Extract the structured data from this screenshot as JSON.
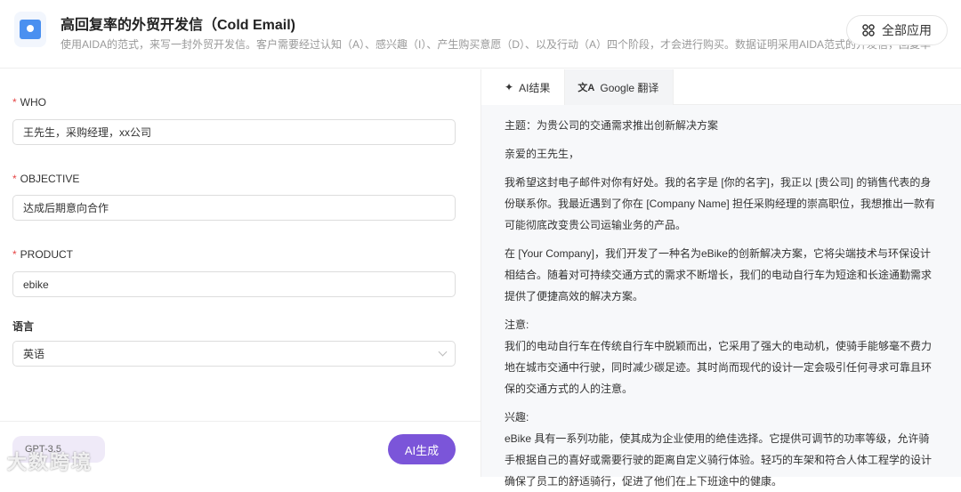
{
  "header": {
    "title": "高回复率的外贸开发信（Cold Email)",
    "description": "使用AIDA的范式，来写一封外贸开发信。客户需要经过认知（A）、感兴趣（I）、产生购买意愿（D）、以及行动（A）四个阶段，才会进行购买。数据证明采用AIDA范式的开发信，回复率",
    "all_apps_label": "全部应用"
  },
  "form": {
    "fields": [
      {
        "label": "WHO",
        "required": true,
        "value": "王先生，采购经理，xx公司"
      },
      {
        "label": "OBJECTIVE",
        "required": true,
        "value": "达成后期意向合作"
      },
      {
        "label": "PRODUCT",
        "required": true,
        "value": "ebike"
      },
      {
        "label": "语言",
        "required": false,
        "value": "英语"
      }
    ],
    "model_badge": "GPT-3.5",
    "watermark": "大数跨境",
    "generate_label": "AI生成"
  },
  "tabs": [
    {
      "label": "AI结果",
      "icon": "sparkle-icon"
    },
    {
      "label": "Google 翻译",
      "icon": "translate-icon"
    }
  ],
  "result": {
    "subject": "主题：为贵公司的交通需求推出创新解决方案",
    "greeting": "亲爱的王先生，",
    "p1": "我希望这封电子邮件对你有好处。我的名字是 [你的名字]，我正以 [贵公司] 的销售代表的身份联系你。我最近遇到了你在 [Company Name] 担任采购经理的崇高职位，我想推出一款有可能彻底改变贵公司运输业务的产品。",
    "p2": "在 [Your Company]，我们开发了一种名为eBike的创新解决方案，它将尖端技术与环保设计相结合。随着对可持续交通方式的需求不断增长，我们的电动自行车为短途和长途通勤需求提供了便捷高效的解决方案。",
    "attention_title": "注意:",
    "attention_body": "我们的电动自行车在传统自行车中脱颖而出，它采用了强大的电动机，使骑手能够毫不费力地在城市交通中行驶，同时减少碳足迹。其时尚而现代的设计一定会吸引任何寻求可靠且环保的交通方式的人的注意。",
    "interest_title": "兴趣:",
    "interest_body": "eBike 具有一系列功能，使其成为企业使用的绝佳选择。它提供可调节的功率等级，允许骑手根据自己的喜好或需要行驶的距离自定义骑行体验。轻巧的车架和符合人体工程学的设计确保了员工的舒适骑行，促进了他们在上下班途中的健康。"
  }
}
